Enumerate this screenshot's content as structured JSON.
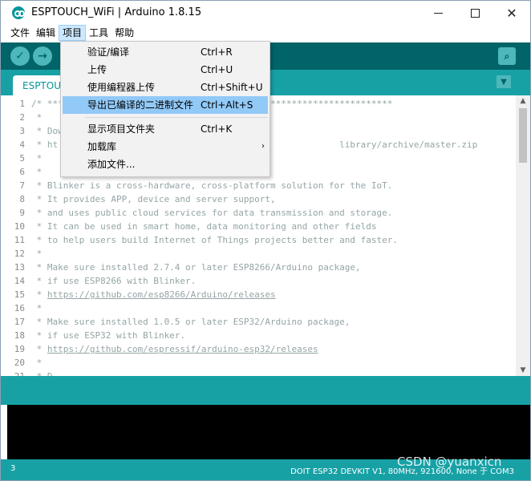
{
  "window": {
    "title": "ESPTOUCH_WiFi | Arduino 1.8.15",
    "minimize_glyph": "",
    "close_glyph": "✕"
  },
  "menubar": {
    "items": [
      {
        "label": "文件"
      },
      {
        "label": "编辑"
      },
      {
        "label": "项目"
      },
      {
        "label": "工具"
      },
      {
        "label": "帮助"
      }
    ]
  },
  "toolbar": {
    "verify_glyph": "✓",
    "upload_glyph": "→",
    "serial_glyph": "⌕"
  },
  "tabs": {
    "active_label": "ESPTOUCH_WiFi",
    "menu_glyph": "▼"
  },
  "dropdown": {
    "items": [
      {
        "label": "验证/编译",
        "shortcut": "Ctrl+R"
      },
      {
        "label": "上传",
        "shortcut": "Ctrl+U"
      },
      {
        "label": "使用编程器上传",
        "shortcut": "Ctrl+Shift+U"
      },
      {
        "label": "导出已编译的二进制文件",
        "shortcut": "Ctrl+Alt+S"
      },
      {
        "label": "显示项目文件夹",
        "shortcut": "Ctrl+K"
      },
      {
        "label": "加载库",
        "arrow": "›"
      },
      {
        "label": "添加文件..."
      }
    ]
  },
  "editor": {
    "line_numbers": [
      "1",
      "2",
      "3",
      "4",
      "5",
      "6",
      "7",
      "8",
      "9",
      "10",
      "11",
      "12",
      "13",
      "14",
      "15",
      "16",
      "17",
      "18",
      "19",
      "20",
      "21"
    ],
    "lines": [
      "/* *****************************************************************",
      " *",
      " * Dow",
      " * ht                                                     library/archive/master.zip",
      " *",
      " *",
      " * Blinker is a cross-hardware, cross-platform solution for the IoT.",
      " * It provides APP, device and server support,",
      " * and uses public cloud services for data transmission and storage.",
      " * It can be used in smart home, data monitoring and other fields",
      " * to help users build Internet of Things projects better and faster.",
      " *",
      " * Make sure installed 2.7.4 or later ESP8266/Arduino package,",
      " * if use ESP8266 with Blinker.",
      " * ",
      " *",
      " * Make sure installed 1.0.5 or later ESP32/Arduino package,",
      " * if use ESP32 with Blinker.",
      " * ",
      " *",
      " * D"
    ],
    "links": {
      "line15": "https://github.com/esp8266/Arduino/releases",
      "line19": "https://github.com/espressif/arduino-esp32/releases"
    },
    "scroll_up": "▲",
    "scroll_down": "▼"
  },
  "status": {
    "line": "3",
    "board": "DOIT ESP32 DEVKIT V1, 80MHz, 921600, None 于 COM3",
    "watermark": "CSDN @yuanxicn"
  }
}
